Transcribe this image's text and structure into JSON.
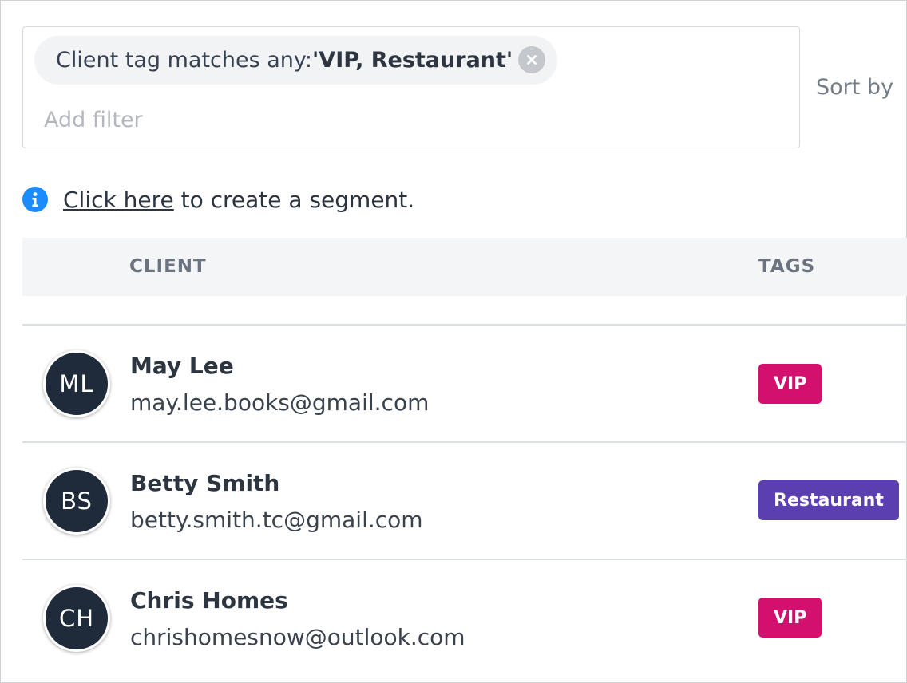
{
  "filter": {
    "chip_prefix": "Client tag matches any: ",
    "chip_value": "'VIP, Restaurant'",
    "chip_close_icon": "close-circle-icon",
    "add_filter_placeholder": "Add filter"
  },
  "sort": {
    "label": "Sort by"
  },
  "info": {
    "icon": "info-icon",
    "link_text": "Click here",
    "message": " to create a segment."
  },
  "table": {
    "columns": {
      "client": "CLIENT",
      "tags": "TAGS"
    },
    "rows": [
      {
        "initials": "ML",
        "name": "May Lee",
        "email": "may.lee.books@gmail.com",
        "tag": "VIP",
        "tag_color": "#d3106e"
      },
      {
        "initials": "BS",
        "name": "Betty Smith",
        "email": "betty.smith.tc@gmail.com",
        "tag": "Restaurant",
        "tag_color": "#5b3fb0"
      },
      {
        "initials": "CH",
        "name": "Chris Homes",
        "email": "chrishomesnow@outlook.com",
        "tag": "VIP",
        "tag_color": "#d3106e"
      }
    ]
  },
  "colors": {
    "accent": "#1a8cff",
    "avatar_bg": "#1f2a3a"
  }
}
